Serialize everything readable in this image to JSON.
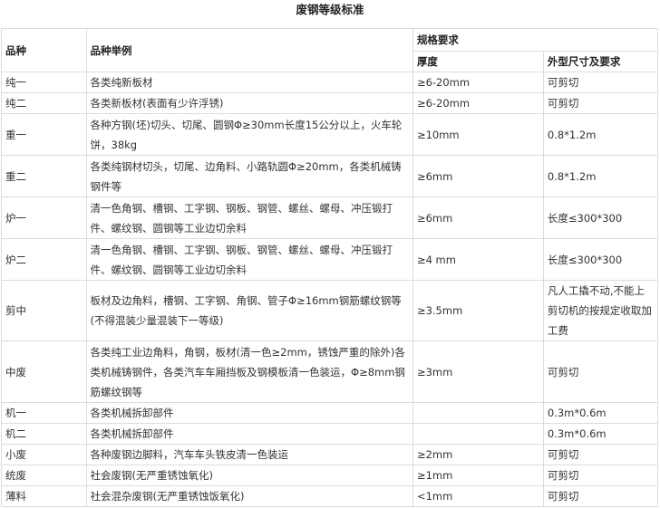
{
  "title": "废钢等级标准",
  "headers": {
    "variety": "品种",
    "example": "品种举例",
    "spec": "规格要求",
    "thickness": "厚度",
    "size": "外型尺寸及要求"
  },
  "rows": [
    {
      "variety": "纯一",
      "example": "各类纯新板材",
      "thickness": "≥6-20mm",
      "size": "可剪切"
    },
    {
      "variety": "纯二",
      "example": "各类新板材(表面有少许浮锈)",
      "thickness": "≥6-20mm",
      "size": "可剪切"
    },
    {
      "variety": "重一",
      "example": "各种方钢(坯)切头、切尾、圆钢Φ≥30mm长度15公分以上，火车轮饼，38kg",
      "thickness": "≥10mm",
      "size": "0.8*1.2m"
    },
    {
      "variety": "重二",
      "example": "各类纯钢材切头，切尾、边角料、小路轨圆Φ≥20mm，各类机械铸钢件等",
      "thickness": "≥6mm",
      "size": "0.8*1.2m"
    },
    {
      "variety": "炉一",
      "example": "清一色角钢、槽钢、工字钢、钢板、钢管、螺丝、螺母、冲压锻打件、螺纹钢、圆钢等工业边切余料",
      "thickness": "≥6mm",
      "size": "长度≤300*300"
    },
    {
      "variety": "炉二",
      "example": "清一色角钢、槽钢、工字钢、钢板、钢管、螺丝、螺母、冲压锻打件、螺纹钢、圆钢等工业边切余料",
      "thickness": "≥4 mm",
      "size": "长度≤300*300"
    },
    {
      "variety": "剪中",
      "example": "板材及边角料，槽钢、工字钢、角钢、管子Φ≥16mm钢筋螺纹钢等(不得混装少量混装下一等级)",
      "thickness": "≥3.5mm",
      "size": "凡人工撬不动,不能上剪切机的按规定收取加工费"
    },
    {
      "variety": "中废",
      "example": "各类纯工业边角料，角钢，板材(清一色≥2mm，锈蚀严重的除外)各类机械铸钢件，各类汽车车厢挡板及钢模板清一色装运，Φ≥8mm钢筋螺纹钢等",
      "thickness": "≥3mm",
      "size": "可剪切"
    },
    {
      "variety": "机一",
      "example": "各类机械拆卸部件",
      "thickness": "",
      "size": "0.3m*0.6m"
    },
    {
      "variety": "机二",
      "example": "各类机械拆卸部件",
      "thickness": "",
      "size": "0.3m*0.6m"
    },
    {
      "variety": "小废",
      "example": "各种废钢边脚料，汽车车头铁皮清一色装运",
      "thickness": "≥2mm",
      "size": "可剪切"
    },
    {
      "variety": "统废",
      "example": "社会废钢(无严重锈蚀氧化)",
      "thickness": "≥1mm",
      "size": "可剪切"
    },
    {
      "variety": "薄料",
      "example": "社会混杂废钢(无严重锈蚀饭氧化)",
      "thickness": "<1mm",
      "size": "可剪切"
    }
  ]
}
